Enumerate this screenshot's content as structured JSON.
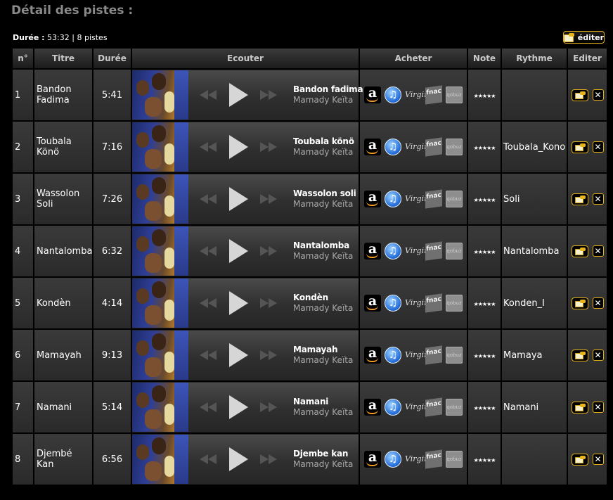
{
  "page": {
    "title": "Détail des pistes :",
    "summary_label": "Durée :",
    "summary_duration": "53:32",
    "summary_sep": "|",
    "summary_count": "8 pistes",
    "edit_label": "éditer"
  },
  "columns": [
    "n°",
    "Titre",
    "Durée",
    "Ecouter",
    "Acheter",
    "Note",
    "Rythme",
    "Editer"
  ],
  "shop_icons": [
    "amazon-icon",
    "itunes-icon",
    "virgin-icon",
    "fnac-icon",
    "qobuz-icon"
  ],
  "shop_labels": {
    "amazon": "a",
    "itunes": "♫",
    "virgin": "Virgin",
    "fnac": "fnac",
    "qobuz": "qobuz"
  },
  "stars": "★★★★★",
  "delete_glyph": "✕",
  "colors": {
    "rythme_link": "#ff8a1a",
    "edit_border": "#e3b01a",
    "page_title": "#8a8a8a"
  },
  "tracks": [
    {
      "num": "1",
      "title": "Bandon Fadima",
      "duration": "5:41",
      "player_title": "Bandon fadima",
      "artist": "Mamady Keïta",
      "rythme": ""
    },
    {
      "num": "2",
      "title": "Toubala Könö",
      "duration": "7:16",
      "player_title": "Toubala könö",
      "artist": "Mamady Keïta",
      "rythme": "Toubala_Kono"
    },
    {
      "num": "3",
      "title": "Wassolon Soli",
      "duration": "7:26",
      "player_title": "Wassolon soli",
      "artist": "Mamady Keïta",
      "rythme": "Soli"
    },
    {
      "num": "4",
      "title": "Nantalomba",
      "duration": "6:32",
      "player_title": "Nantalomba",
      "artist": "Mamady Keïta",
      "rythme": "Nantalomba"
    },
    {
      "num": "5",
      "title": "Kondèn",
      "duration": "4:14",
      "player_title": "Kondèn",
      "artist": "Mamady Keïta",
      "rythme": "Konden_I"
    },
    {
      "num": "6",
      "title": "Mamayah",
      "duration": "9:13",
      "player_title": "Mamayah",
      "artist": "Mamady Keïta",
      "rythme": "Mamaya"
    },
    {
      "num": "7",
      "title": "Namani",
      "duration": "5:14",
      "player_title": "Namani",
      "artist": "Mamady Keïta",
      "rythme": "Namani"
    },
    {
      "num": "8",
      "title": "Djembé Kan",
      "duration": "6:56",
      "player_title": "Djembe kan",
      "artist": "Mamady Keïta",
      "rythme": ""
    }
  ]
}
